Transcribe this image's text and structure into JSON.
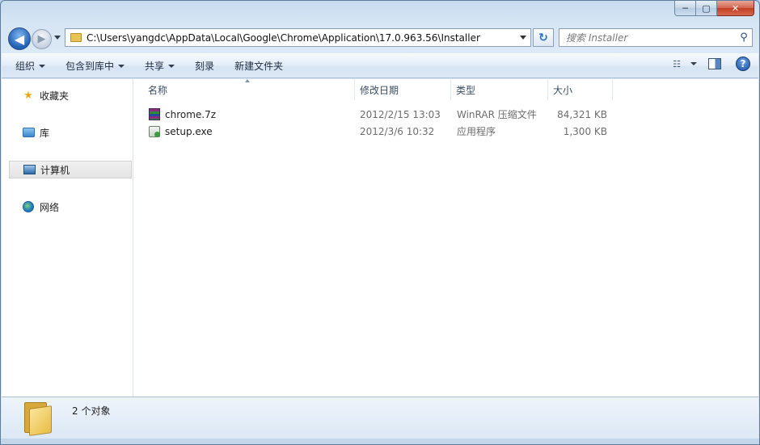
{
  "address": {
    "path": "C:\\Users\\yangdc\\AppData\\Local\\Google\\Chrome\\Application\\17.0.963.56\\Installer"
  },
  "search": {
    "placeholder": "搜索 Installer"
  },
  "caption": {
    "minimize": "─",
    "maximize": "▢",
    "close": "✕"
  },
  "nav": {
    "back": "◀",
    "forward": "▶",
    "refresh": "↻"
  },
  "toolbar": {
    "organize": "组织",
    "include_in_library": "包含到库中",
    "share": "共享",
    "burn": "刻录",
    "new_folder": "新建文件夹",
    "view_glyph": "☷",
    "help_glyph": "?"
  },
  "sidebar": {
    "items": [
      {
        "label": "收藏夹",
        "icon": "star-icon"
      },
      {
        "label": "库",
        "icon": "library-icon"
      },
      {
        "label": "计算机",
        "icon": "computer-icon",
        "selected": true
      },
      {
        "label": "网络",
        "icon": "network-icon"
      }
    ]
  },
  "columns": {
    "name": "名称",
    "date": "修改日期",
    "type": "类型",
    "size": "大小"
  },
  "files": [
    {
      "name": "chrome.7z",
      "date": "2012/2/15 13:03",
      "type": "WinRAR 压缩文件",
      "size": "84,321 KB",
      "icon": "winrar-archive-icon"
    },
    {
      "name": "setup.exe",
      "date": "2012/3/6 10:32",
      "type": "应用程序",
      "size": "1,300 KB",
      "icon": "setup-exe-icon"
    }
  ],
  "status": {
    "count_text": "2 个对象"
  },
  "icons": {
    "star": "★",
    "search": "⚲"
  }
}
